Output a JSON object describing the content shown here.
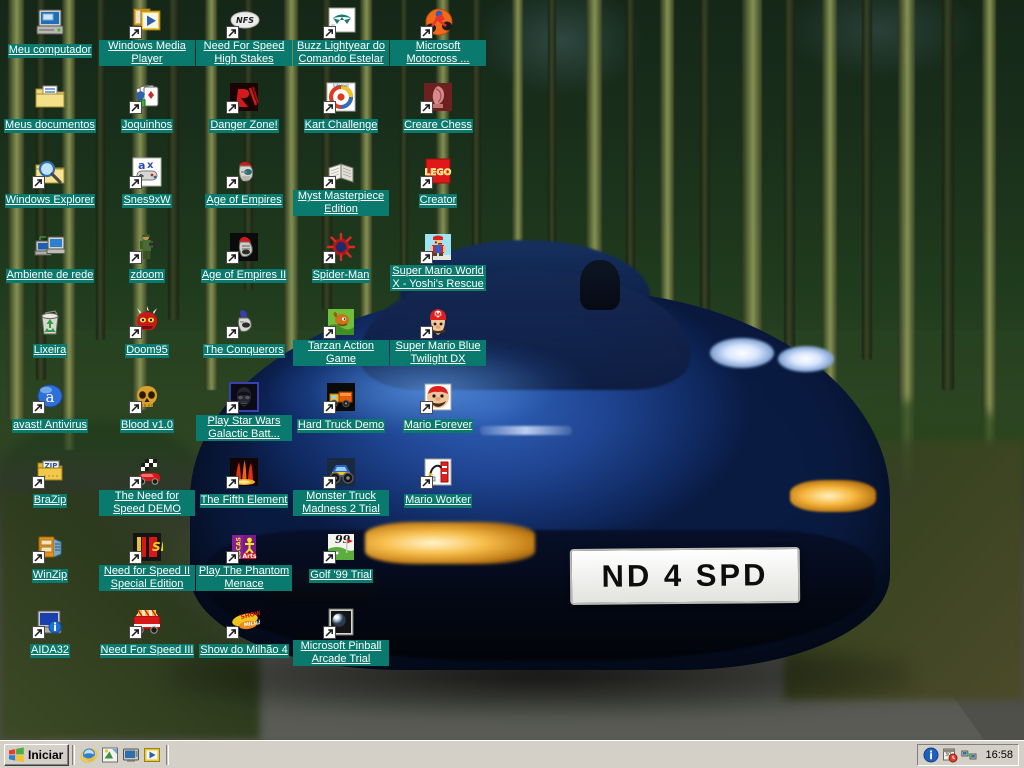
{
  "desktop": {
    "wallpaper": {
      "description": "Blue McLaren F1 sports car on a forest road",
      "license_plate": "ND 4 SPD"
    },
    "label_background_color": "#0b7a6e",
    "label_text_color": "#ffffff",
    "icons": [
      {
        "label": "Meu computador",
        "icon": "my-computer-icon",
        "col": 0,
        "row": 0,
        "shortcut": false
      },
      {
        "label": "Windows Media Player",
        "icon": "windows-media-player-icon",
        "col": 1,
        "row": 0,
        "shortcut": true
      },
      {
        "label": "Need For Speed High Stakes",
        "icon": "nfs-high-stakes-icon",
        "col": 2,
        "row": 0,
        "shortcut": true
      },
      {
        "label": "Buzz Lightyear do Comando Estelar",
        "icon": "buzz-lightyear-icon",
        "col": 3,
        "row": 0,
        "shortcut": true
      },
      {
        "label": "Microsoft Motocross ...",
        "icon": "motocross-madness-icon",
        "col": 4,
        "row": 0,
        "shortcut": true
      },
      {
        "label": "Meus documentos",
        "icon": "my-documents-folder-icon",
        "col": 0,
        "row": 1,
        "shortcut": false
      },
      {
        "label": "Joquinhos",
        "icon": "games-cards-icon",
        "col": 1,
        "row": 1,
        "shortcut": true
      },
      {
        "label": "Danger Zone!",
        "icon": "danger-zone-icon",
        "col": 2,
        "row": 1,
        "shortcut": true
      },
      {
        "label": "Kart Challenge",
        "icon": "kart-challenge-icon",
        "col": 3,
        "row": 1,
        "shortcut": true
      },
      {
        "label": "Creare Chess",
        "icon": "creare-chess-icon",
        "col": 4,
        "row": 1,
        "shortcut": true
      },
      {
        "label": "Windows Explorer",
        "icon": "windows-explorer-icon",
        "col": 0,
        "row": 2,
        "shortcut": true
      },
      {
        "label": "Snes9xW",
        "icon": "snes9x-icon",
        "col": 1,
        "row": 2,
        "shortcut": true
      },
      {
        "label": "Age of Empires",
        "icon": "age-of-empires-icon",
        "col": 2,
        "row": 2,
        "shortcut": true
      },
      {
        "label": "Myst Masterpiece Edition",
        "icon": "myst-book-icon",
        "col": 3,
        "row": 2,
        "shortcut": true
      },
      {
        "label": "Creator",
        "icon": "lego-creator-icon",
        "col": 4,
        "row": 2,
        "shortcut": true
      },
      {
        "label": "Ambiente de rede",
        "icon": "network-neighborhood-icon",
        "col": 0,
        "row": 3,
        "shortcut": false
      },
      {
        "label": "zdoom",
        "icon": "zdoom-marine-icon",
        "col": 1,
        "row": 3,
        "shortcut": true
      },
      {
        "label": "Age of Empires II",
        "icon": "age-of-empires-2-icon",
        "col": 2,
        "row": 3,
        "shortcut": true
      },
      {
        "label": "Spider-Man",
        "icon": "spider-man-icon",
        "col": 3,
        "row": 3,
        "shortcut": true
      },
      {
        "label": "Super Mario World X - Yoshi's Rescue",
        "icon": "super-mario-world-x-icon",
        "col": 4,
        "row": 3,
        "shortcut": true
      },
      {
        "label": "Lixeira",
        "icon": "recycle-bin-icon",
        "col": 0,
        "row": 4,
        "shortcut": false
      },
      {
        "label": "Doom95",
        "icon": "doom95-icon",
        "col": 1,
        "row": 4,
        "shortcut": true
      },
      {
        "label": "The Conquerors",
        "icon": "aoe2-conquerors-icon",
        "col": 2,
        "row": 4,
        "shortcut": true
      },
      {
        "label": "Tarzan Action Game",
        "icon": "tarzan-icon",
        "col": 3,
        "row": 4,
        "shortcut": true
      },
      {
        "label": "Super Mario Blue Twilight DX",
        "icon": "super-mario-blue-twilight-icon",
        "col": 4,
        "row": 4,
        "shortcut": true
      },
      {
        "label": "avast! Antivirus",
        "icon": "avast-antivirus-icon",
        "col": 0,
        "row": 5,
        "shortcut": true
      },
      {
        "label": "Blood v1.0",
        "icon": "blood-skull-icon",
        "col": 1,
        "row": 5,
        "shortcut": true
      },
      {
        "label": "Play Star Wars Galactic Batt...",
        "icon": "star-wars-galactic-battlegrounds-icon",
        "col": 2,
        "row": 5,
        "shortcut": true
      },
      {
        "label": "Hard Truck Demo",
        "icon": "hard-truck-icon",
        "col": 3,
        "row": 5,
        "shortcut": true
      },
      {
        "label": "Mario Forever",
        "icon": "mario-forever-icon",
        "col": 4,
        "row": 5,
        "shortcut": true
      },
      {
        "label": "BraZip",
        "icon": "brazip-icon",
        "col": 0,
        "row": 6,
        "shortcut": true
      },
      {
        "label": "The Need for Speed DEMO",
        "icon": "need-for-speed-demo-icon",
        "col": 1,
        "row": 6,
        "shortcut": true
      },
      {
        "label": "The Fifth Element",
        "icon": "fifth-element-icon",
        "col": 2,
        "row": 6,
        "shortcut": true
      },
      {
        "label": "Monster Truck Madness 2 Trial",
        "icon": "monster-truck-madness-2-icon",
        "col": 3,
        "row": 6,
        "shortcut": true
      },
      {
        "label": "Mario Worker",
        "icon": "mario-worker-icon",
        "col": 4,
        "row": 6,
        "shortcut": true
      },
      {
        "label": "WinZip",
        "icon": "winzip-icon",
        "col": 0,
        "row": 7,
        "shortcut": true
      },
      {
        "label": "Need for Speed II Special Edition",
        "icon": "nfs2-se-icon",
        "col": 1,
        "row": 7,
        "shortcut": true
      },
      {
        "label": "Play The Phantom Menace",
        "icon": "lucasarts-phantom-menace-icon",
        "col": 2,
        "row": 7,
        "shortcut": true
      },
      {
        "label": "Golf '99 Trial",
        "icon": "golf-99-icon",
        "col": 3,
        "row": 7,
        "shortcut": true
      },
      {
        "label": "AIDA32",
        "icon": "aida32-icon",
        "col": 0,
        "row": 8,
        "shortcut": true
      },
      {
        "label": "Need For Speed III",
        "icon": "nfs3-icon",
        "col": 1,
        "row": 8,
        "shortcut": true
      },
      {
        "label": "Show do Milhão 4",
        "icon": "show-do-milhao-icon",
        "col": 2,
        "row": 8,
        "shortcut": true
      },
      {
        "label": "Microsoft Pinball Arcade Trial",
        "icon": "pinball-arcade-icon",
        "col": 3,
        "row": 8,
        "shortcut": true
      }
    ]
  },
  "taskbar": {
    "start_label": "Iniciar",
    "quick_launch": [
      {
        "name": "internet-explorer-icon",
        "title": "Internet Explorer"
      },
      {
        "name": "show-desktop-icon",
        "title": "Show Desktop"
      },
      {
        "name": "tv-viewer-icon",
        "title": "TV Viewer"
      },
      {
        "name": "windows-media-player-icon",
        "title": "Windows Media Player"
      }
    ],
    "tray_icons": [
      {
        "name": "avast-tray-icon",
        "title": "avast! Antivirus"
      },
      {
        "name": "scheduler-tray-icon",
        "title": "Task Scheduler"
      },
      {
        "name": "network-tray-icon",
        "title": "Network"
      }
    ],
    "clock": "16:58"
  }
}
